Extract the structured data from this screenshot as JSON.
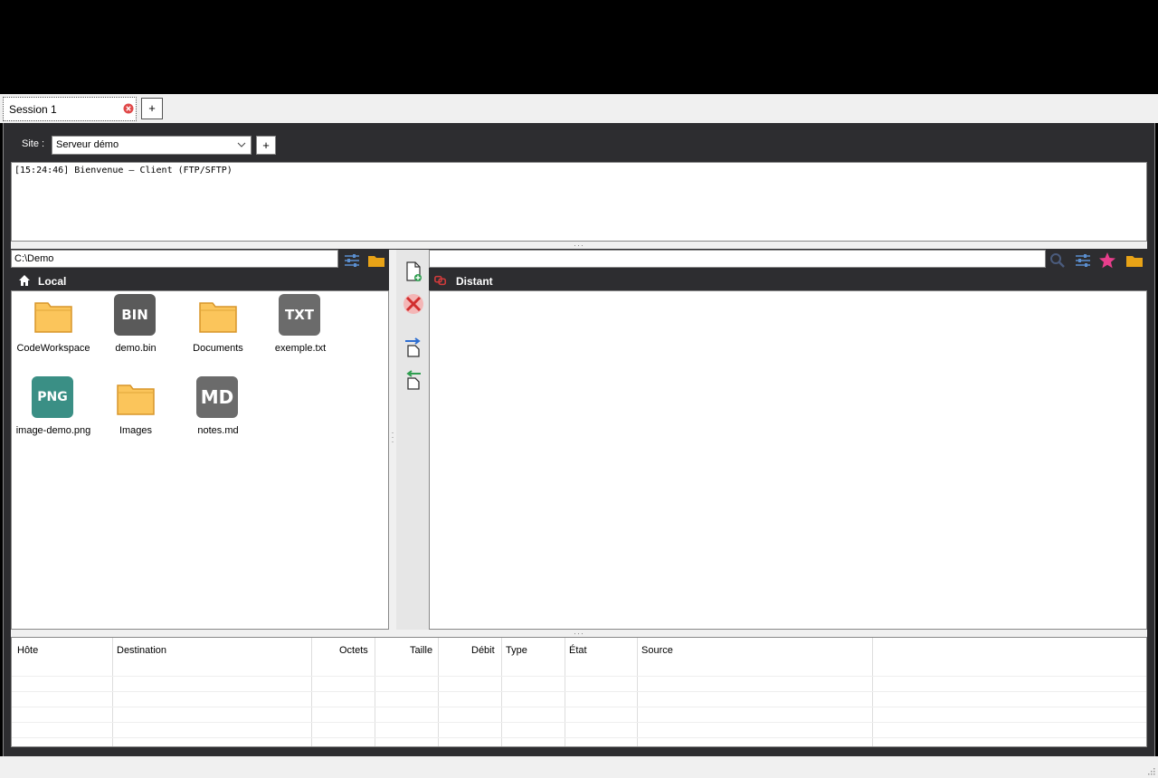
{
  "session_tab": {
    "label": "Session 1",
    "add_label": "+"
  },
  "site": {
    "label": "Site :",
    "selected": "Serveur démo",
    "add_label": "+"
  },
  "log": {
    "lines": [
      "[15:24:46] Bienvenue — Client (FTP/SFTP)"
    ]
  },
  "local": {
    "path": "C:\\Demo",
    "title": "Local",
    "files": [
      {
        "name": "CodeWorkspace",
        "kind": "folder"
      },
      {
        "name": "demo.bin",
        "kind": "badge",
        "badge": "BIN",
        "color": "#5a5a5a"
      },
      {
        "name": "Documents",
        "kind": "folder"
      },
      {
        "name": "exemple.txt",
        "kind": "badge",
        "badge": "TXT",
        "color": "#6b6b6b"
      },
      {
        "name": "image-demo.png",
        "kind": "badge",
        "badge": "PNG",
        "color": "#3a8f85"
      },
      {
        "name": "Images",
        "kind": "folder"
      },
      {
        "name": "notes.md",
        "kind": "badge",
        "badge": "MD",
        "color": "#6b6b6b"
      }
    ]
  },
  "remote": {
    "path": "",
    "title": "Distant"
  },
  "queue": {
    "columns": [
      "Hôte",
      "Destination",
      "Octets",
      "Taille",
      "Débit",
      "Type",
      "État",
      "Source"
    ]
  },
  "colors": {
    "folder": "#fbc55b",
    "folder_edge": "#d8952a",
    "accent_pink": "#e83e8c",
    "frame": "#2d2d30"
  }
}
